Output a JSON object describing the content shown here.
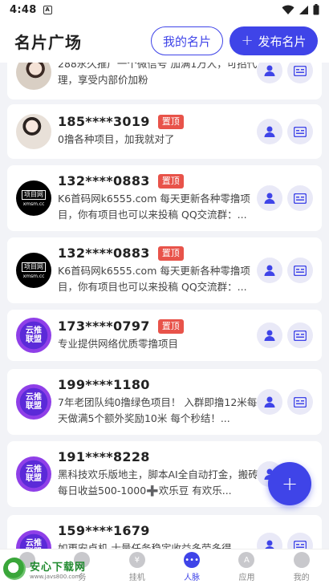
{
  "status": {
    "time": "4:48",
    "notif_glyph": "A"
  },
  "header": {
    "title": "名片广场",
    "my_card": "我的名片",
    "publish": "发布名片"
  },
  "cards": [
    {
      "name": "",
      "desc": "288永久推广一个微信号 加满1万人，可招代理，享受内部价加粉",
      "pinned": false
    },
    {
      "name": "185****3019",
      "badge": "置顶",
      "desc": "0撸各种项目，加我就对了"
    },
    {
      "name": "132****0883",
      "badge": "置顶",
      "desc": "K6首码网k6555.com 每天更新各种零撸项目，你有项目也可以来投稿 QQ交流群：..."
    },
    {
      "name": "132****0883",
      "badge": "置顶",
      "desc": "K6首码网k6555.com 每天更新各种零撸项目，你有项目也可以来投稿 QQ交流群：..."
    },
    {
      "name": "173****0797",
      "badge": "置顶",
      "desc": "专业提供网络优质零撸项目"
    },
    {
      "name": "199****1180",
      "desc": "7年老团队纯0撸绿色项目！ 入群即撸12米每天做满5个额外奖励10米 每个秒结！..."
    },
    {
      "name": "191****8228",
      "desc": "黑科技欢乐版地主，脚本AI全自动打金，搬砖每日收益500-1000➕欢乐豆 有欢乐..."
    },
    {
      "name": "159****1679",
      "desc": "如更安卓机 士量任务稳定收益多劳多得"
    }
  ],
  "avatar_texts": {
    "black_l1": "项目网",
    "black_l2": "xmsm.cc",
    "cloud_l1": "云推",
    "cloud_l2": "联盟"
  },
  "fab": "+",
  "tabs": [
    {
      "label": ""
    },
    {
      "label": "务"
    },
    {
      "label": "挂机"
    },
    {
      "label": "人脉"
    },
    {
      "label": "应用"
    },
    {
      "label": "我的"
    }
  ],
  "watermark": {
    "name": "安心下载网",
    "url": "www.javs800.com"
  },
  "colors": {
    "primary": "#3f44e8",
    "badge": "#e8534a",
    "action_bg": "#e9e9f7"
  }
}
